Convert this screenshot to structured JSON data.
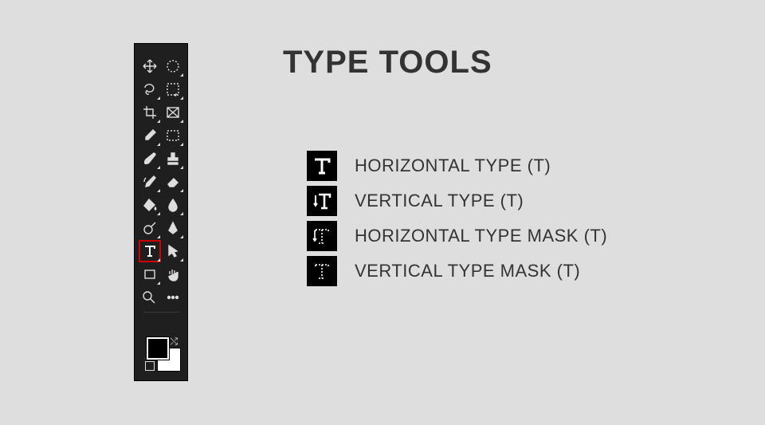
{
  "title": "TYPE TOOLS",
  "toolbar": {
    "tools": [
      {
        "id": "move-tool",
        "fly": false
      },
      {
        "id": "marquee-tool",
        "fly": true
      },
      {
        "id": "lasso-tool",
        "fly": true
      },
      {
        "id": "quick-select-tool",
        "fly": true
      },
      {
        "id": "crop-tool",
        "fly": true
      },
      {
        "id": "slice-tool",
        "fly": true
      },
      {
        "id": "eyedropper-tool",
        "fly": true
      },
      {
        "id": "frame-tool",
        "fly": true
      },
      {
        "id": "brush-tool",
        "fly": true
      },
      {
        "id": "clone-stamp-tool",
        "fly": true
      },
      {
        "id": "history-brush-tool",
        "fly": true
      },
      {
        "id": "eraser-tool",
        "fly": true
      },
      {
        "id": "paint-bucket-tool",
        "fly": true
      },
      {
        "id": "blur-tool",
        "fly": true
      },
      {
        "id": "dodge-tool",
        "fly": true
      },
      {
        "id": "pen-tool",
        "fly": true
      },
      {
        "id": "type-tool",
        "fly": true,
        "selected": true
      },
      {
        "id": "path-select-tool",
        "fly": true
      },
      {
        "id": "rectangle-tool",
        "fly": true
      },
      {
        "id": "hand-tool",
        "fly": false
      },
      {
        "id": "zoom-tool",
        "fly": false
      },
      {
        "id": "more-tool",
        "fly": false
      }
    ],
    "footer": [
      {
        "id": "edit-toolbar"
      },
      {
        "id": "quick-mask"
      },
      {
        "id": "screen-mode"
      }
    ]
  },
  "legend": [
    {
      "icon": "horizontal-type-icon",
      "label": "HORIZONTAL TYPE (T)"
    },
    {
      "icon": "vertical-type-icon",
      "label": "VERTICAL TYPE (T)"
    },
    {
      "icon": "horizontal-type-mask-icon",
      "label": "HORIZONTAL TYPE MASK (T)"
    },
    {
      "icon": "vertical-type-mask-icon",
      "label": "VERTICAL TYPE MASK (T)"
    }
  ]
}
